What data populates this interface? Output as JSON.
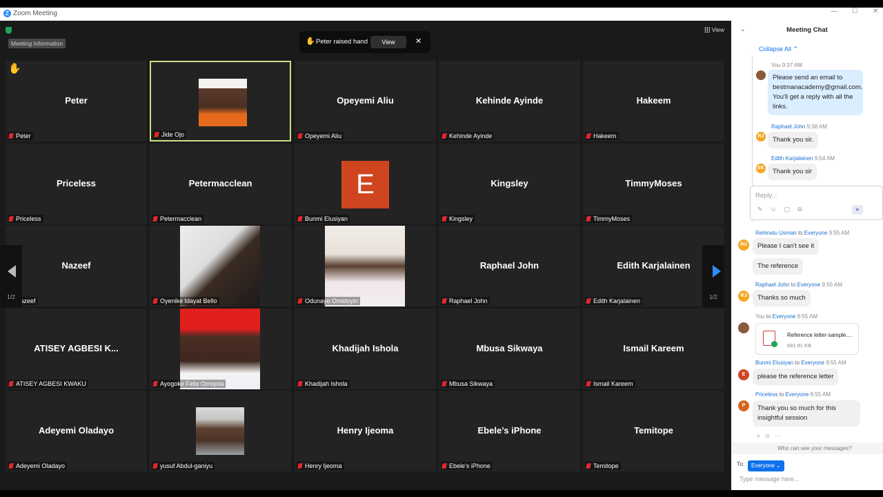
{
  "window": {
    "title": "Zoom Meeting"
  },
  "toolbar": {
    "meeting_info": "Meeting Information",
    "view_label": "View"
  },
  "notification": {
    "text": "Peter raised hand",
    "view_button": "View",
    "close": "✕",
    "hand": "✋"
  },
  "pagination": {
    "left": "1/2",
    "right": "1/2"
  },
  "tiles": [
    {
      "name": "Peter",
      "label": "Peter",
      "raised": "✋"
    },
    {
      "name": "",
      "label": "Jide Ojo"
    },
    {
      "name": "Opeyemi Aliu",
      "label": "Opeyemi Aliu"
    },
    {
      "name": "Kehinde Ayinde",
      "label": "Kehinde Ayinde"
    },
    {
      "name": "Hakeem",
      "label": "Hakeem"
    },
    {
      "name": "Priceless",
      "label": "Priceless"
    },
    {
      "name": "Petermacclean",
      "label": "Petermacclean"
    },
    {
      "name": "",
      "label": "Bunmi Elusiyan",
      "avatar": "E"
    },
    {
      "name": "Kingsley",
      "label": "Kingsley"
    },
    {
      "name": "TimmyMoses",
      "label": "TimmyMoses"
    },
    {
      "name": "Nazeef",
      "label": "Nazeef"
    },
    {
      "name": "",
      "label": "Oyenike Idayat Bello"
    },
    {
      "name": "",
      "label": "Odunayo Omidoyin"
    },
    {
      "name": "Raphael John",
      "label": "Raphael John"
    },
    {
      "name": "Edith Karjalainen",
      "label": "Edith Karjalainen"
    },
    {
      "name": "ATISEY  AGBESI  K...",
      "label": "ATISEY AGBESI KWAKU"
    },
    {
      "name": "",
      "label": "Ayogoke Felix Omojola"
    },
    {
      "name": "Khadijah Ishola",
      "label": "Khadijah Ishola"
    },
    {
      "name": "Mbusa Sikwaya",
      "label": "Mbusa Sikwaya"
    },
    {
      "name": "Ismail Kareem",
      "label": "Ismail Kareem"
    },
    {
      "name": "Adeyemi Oladayo",
      "label": "Adeyemi Oladayo"
    },
    {
      "name": "",
      "label": "yusuf Abdul-ganiyu"
    },
    {
      "name": "Henry Ijeoma",
      "label": "Henry Ijeoma"
    },
    {
      "name": "Ebele’s iPhone",
      "label": "Ebele’s iPhone"
    },
    {
      "name": "Temitope",
      "label": "Temitope"
    }
  ],
  "chat": {
    "title": "Meeting Chat",
    "collapse_all": "Collapse All ⌃",
    "thread": [
      {
        "sender": "You",
        "time": "9:37 AM",
        "text": "Please send an email to bestmanacademy@gmail.com. You'll get a reply with all the links."
      },
      {
        "sender": "Raphael John",
        "time": "9:38 AM",
        "initials": "RJ",
        "text": "Thank you sir."
      },
      {
        "sender": "Edith Karjalainen",
        "time": "9:54 AM",
        "initials": "EK",
        "text": "Thank you sir"
      }
    ],
    "reply_placeholder": "Reply...",
    "messages": [
      {
        "sender": "Rehinatu Usman",
        "to": "to",
        "audience": "Everyone",
        "time": "9:55 AM",
        "initials": "RU",
        "texts": [
          "Please I can't see it",
          "The reference"
        ]
      },
      {
        "sender": "Raphael John",
        "to": "to",
        "audience": "Everyone",
        "time": "9:55 AM",
        "initials": "RJ",
        "texts": [
          "Thanks so much"
        ]
      },
      {
        "sender": "You",
        "to": "to",
        "audience": "Everyone",
        "time": "9:55 AM",
        "file_name": "Reference letter-sample....",
        "file_size": "681.81 KB"
      },
      {
        "sender": "Bunmi Elusiyan",
        "to": "to",
        "audience": "Everyone",
        "time": "9:55 AM",
        "initials": "E",
        "texts": [
          "please the reference letter"
        ]
      },
      {
        "sender": "Priceless",
        "to": "to",
        "audience": "Everyone",
        "time": "9:55 AM",
        "initials": "P",
        "texts": [
          "Thank you so much for this insightful session"
        ]
      }
    ],
    "who_can_see": "Who can see your messages?",
    "to_label": "To:",
    "to_value": "Everyone ⌄",
    "input_placeholder": "Type message here..."
  },
  "colors": {
    "accent": "#0e72ed",
    "active_speaker": "#cbe186",
    "raise_hand": "#f6b12e",
    "muted": "#e02828"
  }
}
